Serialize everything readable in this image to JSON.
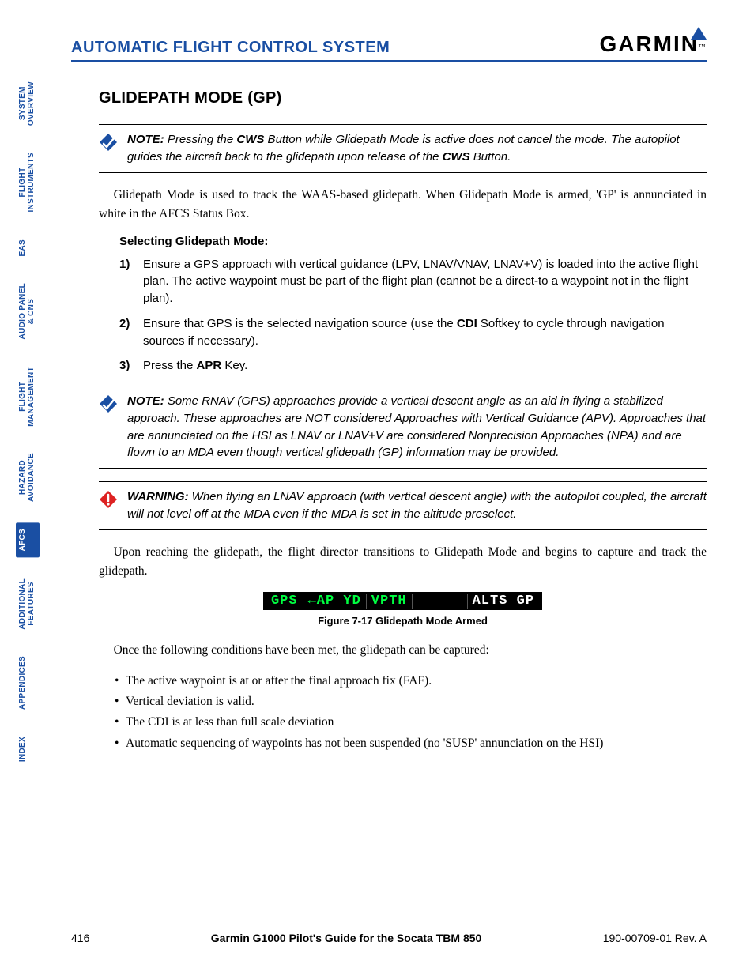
{
  "header": {
    "title": "AUTOMATIC FLIGHT CONTROL SYSTEM",
    "logo_text": "GARMIN",
    "logo_tm": "™"
  },
  "tabs": [
    {
      "label": "SYSTEM\nOVERVIEW",
      "active": false
    },
    {
      "label": "FLIGHT\nINSTRUMENTS",
      "active": false
    },
    {
      "label": "EAS",
      "active": false
    },
    {
      "label": "AUDIO PANEL\n& CNS",
      "active": false
    },
    {
      "label": "FLIGHT\nMANAGEMENT",
      "active": false
    },
    {
      "label": "HAZARD\nAVOIDANCE",
      "active": false
    },
    {
      "label": "AFCS",
      "active": true
    },
    {
      "label": "ADDITIONAL\nFEATURES",
      "active": false
    },
    {
      "label": "APPENDICES",
      "active": false
    },
    {
      "label": "INDEX",
      "active": false
    }
  ],
  "section": {
    "title": "GLIDEPATH MODE (GP)"
  },
  "note1": {
    "label": "NOTE:",
    "pre": " Pressing the ",
    "b1": "CWS",
    "mid": " Button while Glidepath Mode is active does not cancel the mode.  The autopilot guides the aircraft back to the glidepath upon release of the ",
    "b2": "CWS",
    "post": " Button."
  },
  "para1": "Glidepath Mode is used to track the WAAS-based glidepath.  When Glidepath Mode is armed, 'GP' is annunciated in white in the AFCS Status Box.",
  "subhead": "Selecting Glidepath Mode:",
  "steps": [
    {
      "n": "1)",
      "text": "Ensure a GPS approach with vertical guidance (LPV, LNAV/VNAV, LNAV+V) is loaded into the active flight plan. The active waypoint must be part of the flight plan (cannot be a direct-to a waypoint not in the flight plan)."
    },
    {
      "n": "2)",
      "pre": "Ensure that GPS is the selected navigation source (use the ",
      "b": "CDI",
      "post": " Softkey to cycle through navigation sources if necessary)."
    },
    {
      "n": "3)",
      "pre": "Press the ",
      "b": "APR",
      "post": " Key."
    }
  ],
  "note2": {
    "label": "NOTE:",
    "text": " Some RNAV (GPS) approaches provide a vertical descent angle as an aid in flying a stabilized approach.  These approaches are NOT considered Approaches with Vertical Guidance (APV).  Approaches that are annunciated on the HSI as LNAV or LNAV+V are considered Nonprecision Approaches (NPA) and are flown to an MDA even though vertical glidepath (GP) information may be provided."
  },
  "warn": {
    "label": "WARNING:",
    "text": " When flying an LNAV approach (with vertical descent angle) with the autopilot coupled, the aircraft will not level off at the MDA even if the MDA is set in the altitude preselect."
  },
  "para2": "Upon reaching the glidepath, the flight director transitions to Glidepath Mode and begins to capture and track the glidepath.",
  "afcs": {
    "seg1": "GPS",
    "seg2": "←AP YD",
    "seg3": "VPTH",
    "seg4": "ALTS GP"
  },
  "figure_caption": "Figure 7-17  Glidepath Mode Armed",
  "para3": "Once the following conditions have been met, the glidepath can be captured:",
  "bullets": [
    "The active waypoint is at or after the final approach fix (FAF).",
    "Vertical deviation is valid.",
    "The CDI is at less than full scale deviation",
    "Automatic sequencing of waypoints has not been suspended (no 'SUSP' annunciation on the HSI)"
  ],
  "footer": {
    "page": "416",
    "title": "Garmin G1000 Pilot's Guide for the Socata TBM 850",
    "rev": "190-00709-01  Rev. A"
  }
}
